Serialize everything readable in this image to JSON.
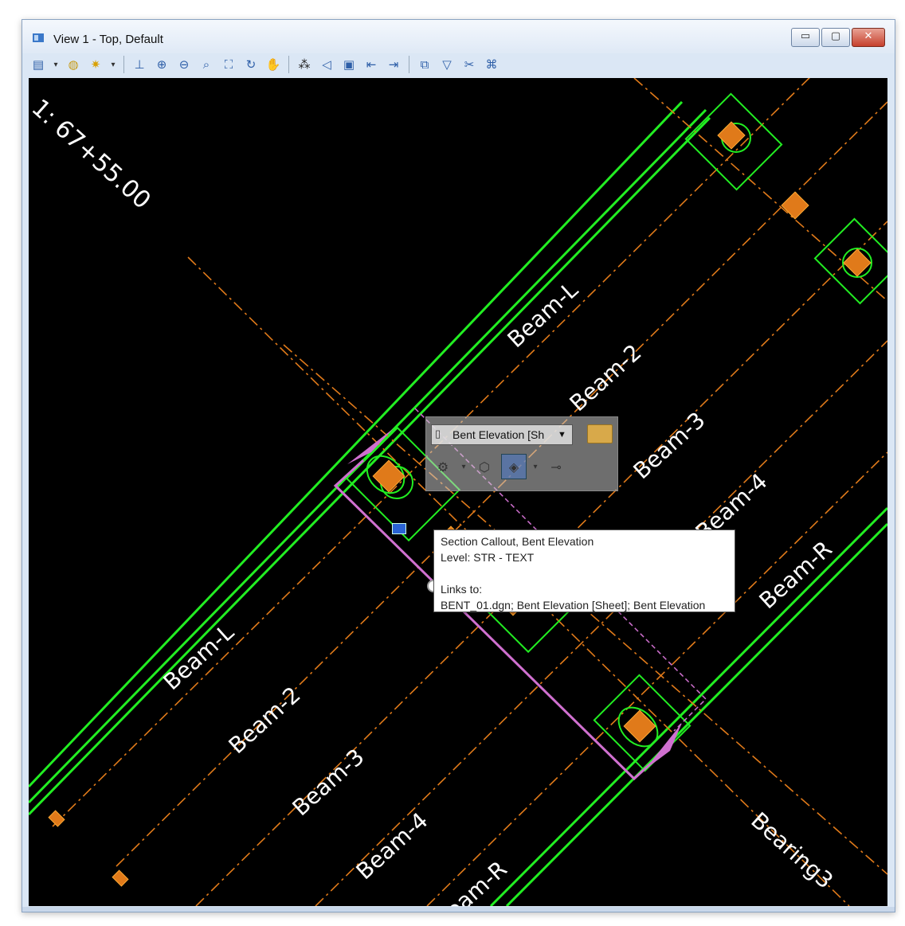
{
  "window": {
    "title": "View 1 - Top, Default",
    "controls": {
      "minimize": "▭",
      "maximize": "▢",
      "close": "✕"
    }
  },
  "toolbar": {
    "icons": [
      "view-attributes-icon",
      "display-style-icon",
      "lighting-icon",
      "update-view-icon",
      "zoom-in-icon",
      "zoom-out-icon",
      "window-area-icon",
      "fit-view-icon",
      "rotate-view-icon",
      "pan-view-icon",
      "walk-icon",
      "view-previous-icon",
      "view-next-icon",
      "copy-view-icon",
      "clip-volume-icon",
      "clip-mask-icon",
      "camera-icon"
    ]
  },
  "drawing": {
    "station_label": "1: 67+55.00",
    "upper_labels": [
      "Beam-L",
      "Beam-2",
      "Beam-3",
      "Beam-4",
      "Beam-R"
    ],
    "lower_labels": [
      "Beam-L",
      "Beam-2",
      "Beam-3",
      "Beam-4",
      "Beam-R"
    ],
    "bearing_label": "Bearing3",
    "colors": {
      "background": "#000000",
      "beam_line": "#22ee22",
      "centerline": "#e07a1a",
      "callout": "#d070d0",
      "text": "#ffffff"
    }
  },
  "floatbar": {
    "dropdown_value": "Bent Elevation [Sh",
    "tools": [
      "reference-icon",
      "section-cut-icon",
      "clip-icon",
      "link-icon"
    ]
  },
  "tooltip": {
    "line1": "Section Callout, Bent Elevation",
    "line2": "Level: STR - TEXT",
    "line3": "Links to:",
    "line4": "BENT_01.dgn; Bent Elevation [Sheet]; Bent Elevation"
  }
}
